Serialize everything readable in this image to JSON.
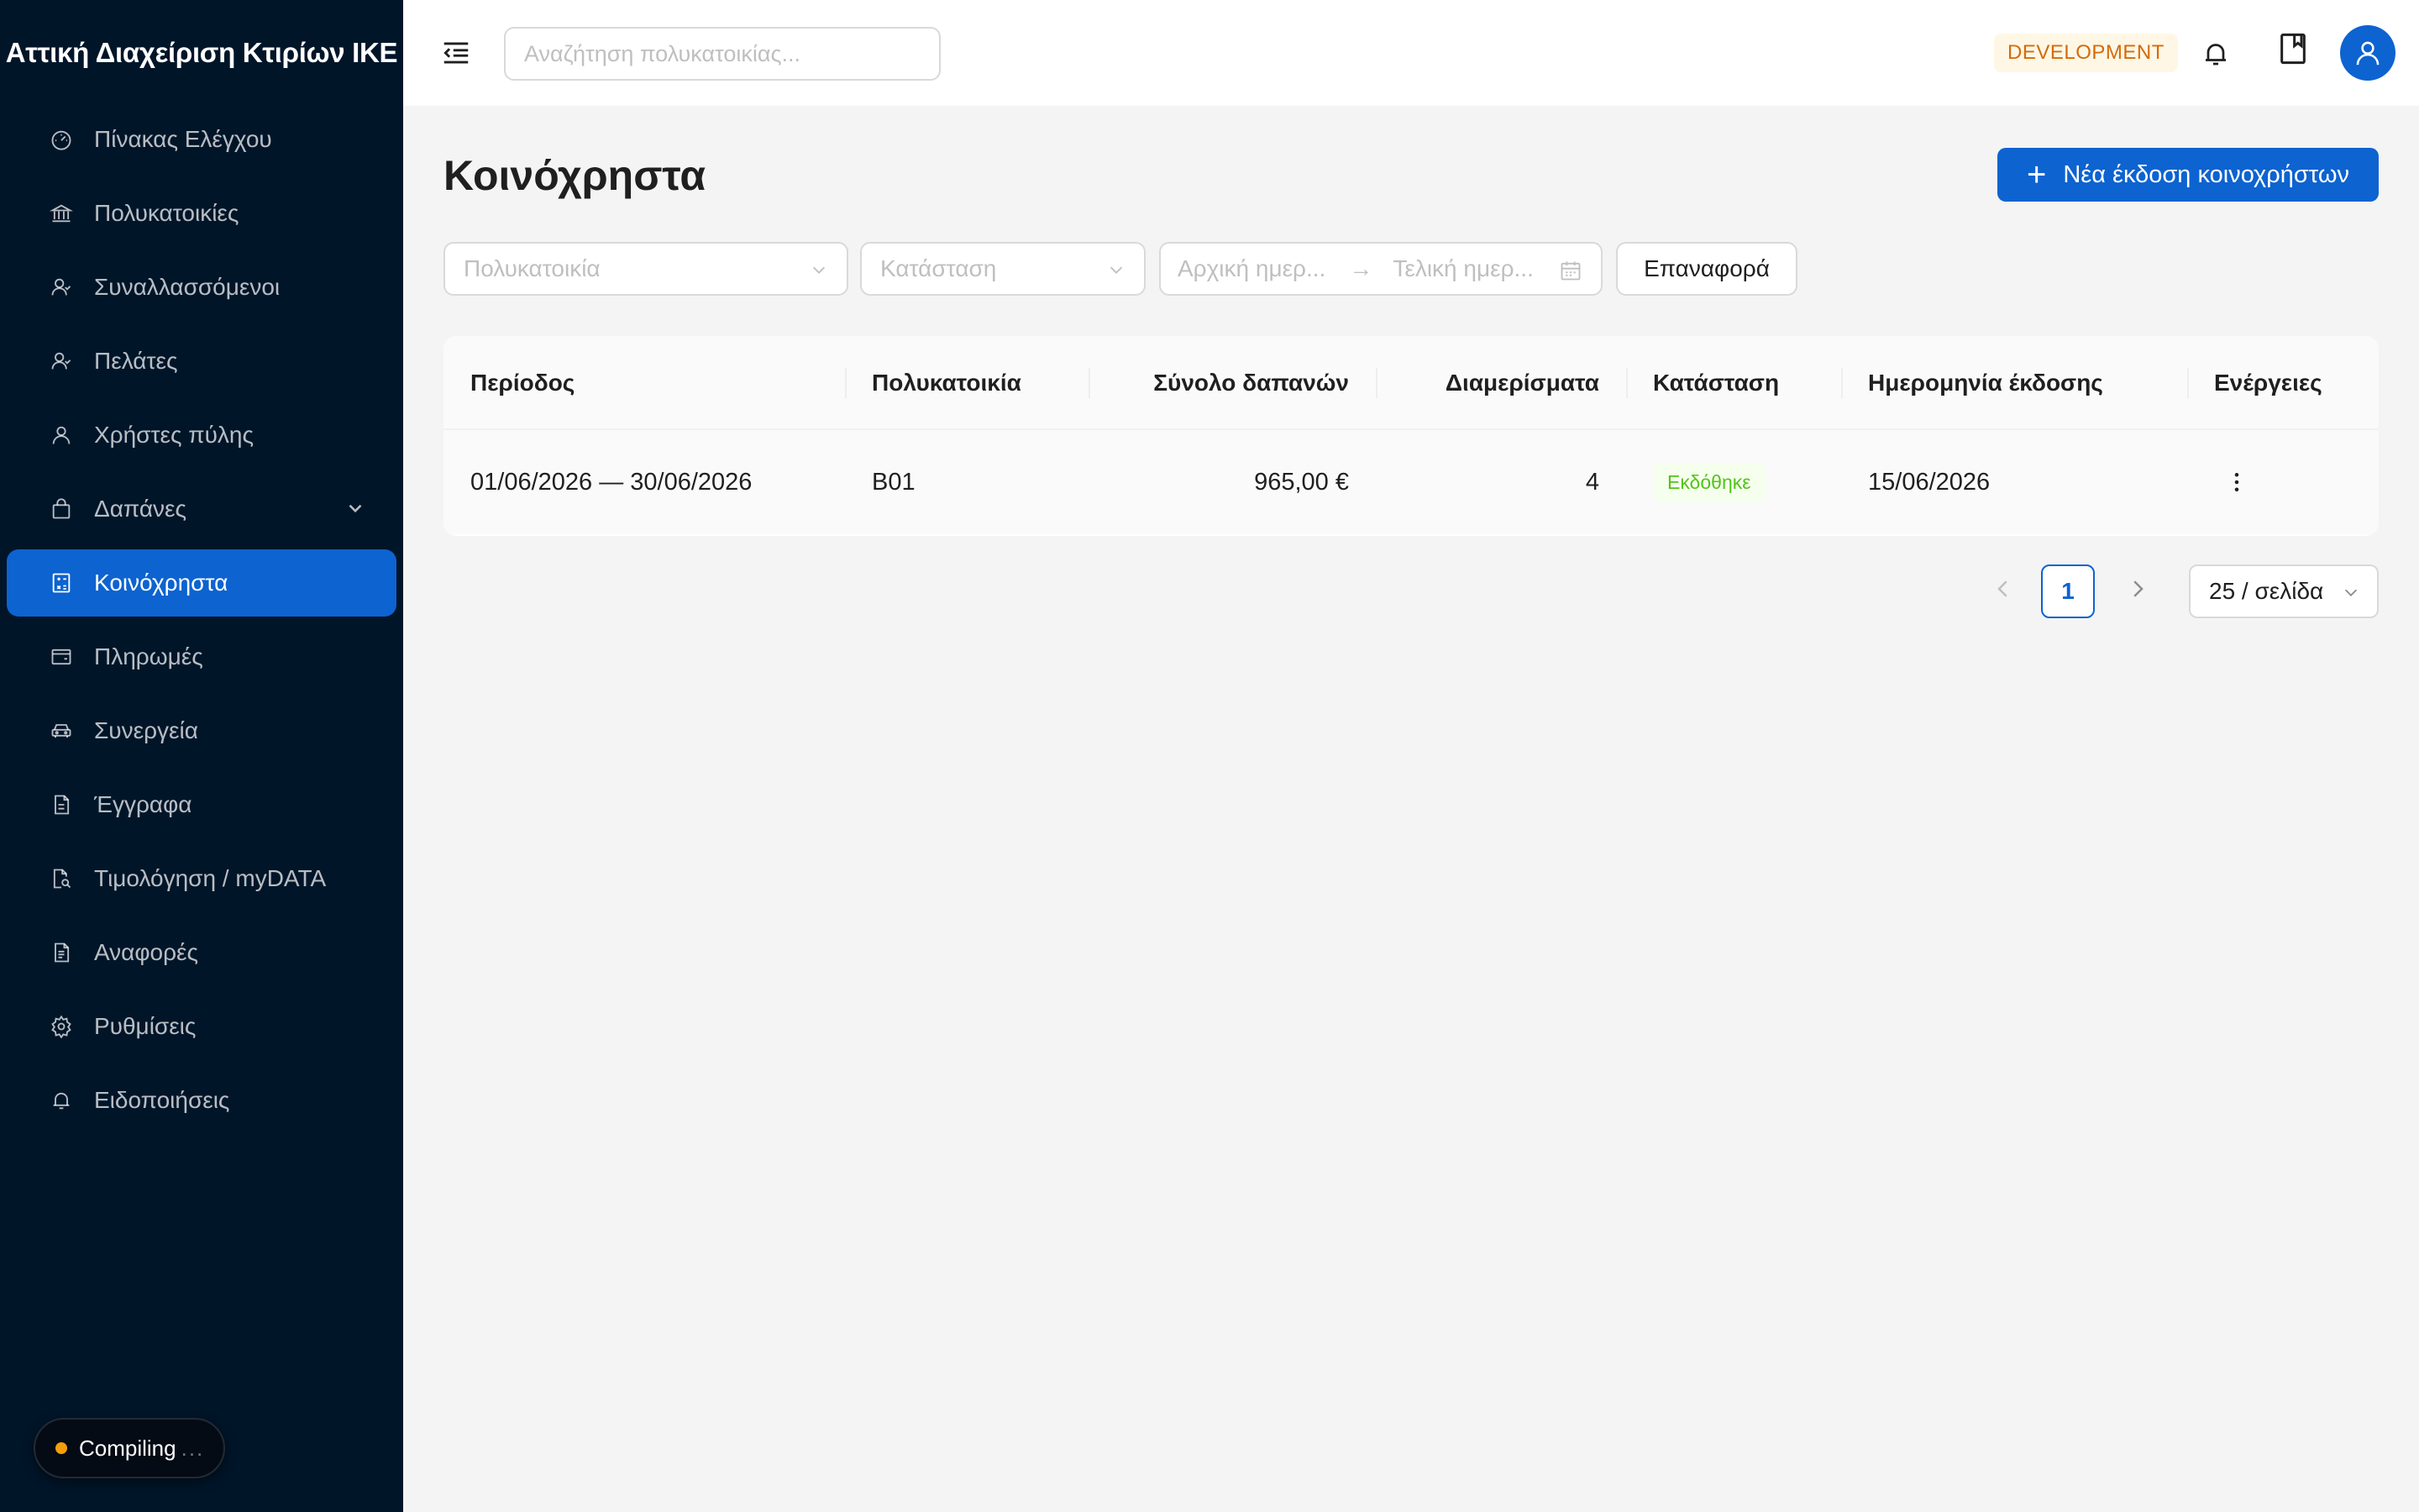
{
  "brand": {
    "name": "Αττική Διαχείριση Κτιρίων ΙΚΕ"
  },
  "sidebar": {
    "items": [
      {
        "label": "Πίνακας Ελέγχου",
        "icon": "dashboard-icon"
      },
      {
        "label": "Πολυκατοικίες",
        "icon": "bank-icon"
      },
      {
        "label": "Συναλλασσόμενοι",
        "icon": "contacts-icon"
      },
      {
        "label": "Πελάτες",
        "icon": "contacts-icon"
      },
      {
        "label": "Χρήστες πύλης",
        "icon": "user-icon"
      },
      {
        "label": "Δαπάνες",
        "icon": "shopping-bag-icon",
        "expandable": true
      },
      {
        "label": "Κοινόχρηστα",
        "icon": "calculator-icon",
        "active": true
      },
      {
        "label": "Πληρωμές",
        "icon": "wallet-icon"
      },
      {
        "label": "Συνεργεία",
        "icon": "car-icon"
      },
      {
        "label": "Έγγραφα",
        "icon": "file-icon"
      },
      {
        "label": "Τιμολόγηση / myDATA",
        "icon": "file-search-icon"
      },
      {
        "label": "Αναφορές",
        "icon": "file-text-icon"
      },
      {
        "label": "Ρυθμίσεις",
        "icon": "gear-icon"
      },
      {
        "label": "Ειδοποιήσεις",
        "icon": "bell-icon"
      }
    ]
  },
  "dev_indicator": {
    "label": "Compiling",
    "dots": "..."
  },
  "header": {
    "search_placeholder": "Αναζήτηση πολυκατοικίας...",
    "env_badge": "DEVELOPMENT"
  },
  "page": {
    "title": "Κοινόχρηστα",
    "new_button": "Νέα έκδοση κοινοχρήστων"
  },
  "filters": {
    "building_placeholder": "Πολυκατοικία",
    "status_placeholder": "Κατάσταση",
    "start_date_placeholder": "Αρχική ημερ...",
    "end_date_placeholder": "Τελική ημερ...",
    "reset_button": "Επαναφορά"
  },
  "table": {
    "columns": [
      "Περίοδος",
      "Πολυκατοικία",
      "Σύνολο δαπανών",
      "Διαμερίσματα",
      "Κατάσταση",
      "Ημερομηνία έκδοσης",
      "Ενέργειες"
    ],
    "rows": [
      {
        "period": "01/06/2026 — 30/06/2026",
        "building": "B01",
        "total": "965,00 €",
        "apartments": "4",
        "status": "Εκδόθηκε",
        "issue_date": "15/06/2026"
      }
    ]
  },
  "pagination": {
    "current_page": "1",
    "page_size": "25 / σελίδα"
  },
  "colors": {
    "sidebar_bg": "#011529",
    "primary": "#0d63d0",
    "status_success": "#52c41a",
    "env_badge": "#d46b08"
  }
}
